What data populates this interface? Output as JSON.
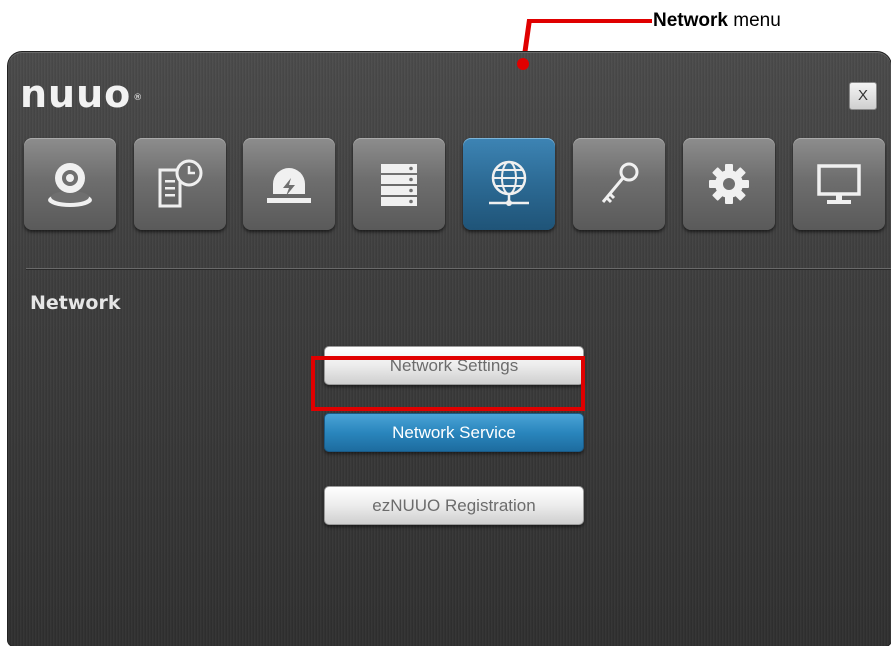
{
  "annotation": {
    "bold": "Network",
    "rest": " menu",
    "color": "#e00000"
  },
  "window": {
    "logo": "nuuo",
    "logo_reg": "®",
    "close_label": "X"
  },
  "toolbar": {
    "items": [
      {
        "name": "camera",
        "icon": "camera-icon",
        "active": false
      },
      {
        "name": "schedule",
        "icon": "schedule-document-icon",
        "active": false
      },
      {
        "name": "event",
        "icon": "alarm-light-icon",
        "active": false
      },
      {
        "name": "storage",
        "icon": "storage-server-icon",
        "active": false
      },
      {
        "name": "network",
        "icon": "globe-network-icon",
        "active": true
      },
      {
        "name": "user",
        "icon": "key-icon",
        "active": false
      },
      {
        "name": "system",
        "icon": "gear-icon",
        "active": false
      },
      {
        "name": "display",
        "icon": "monitor-icon",
        "active": false
      }
    ],
    "active_color": "#2c6a94"
  },
  "section": {
    "title": "Network"
  },
  "menu": {
    "items": [
      {
        "label": "Network Settings",
        "selected": false
      },
      {
        "label": "Network Service",
        "selected": true
      },
      {
        "label": "ezNUUO Registration",
        "selected": false
      }
    ],
    "selected_color": "#2a86bd"
  }
}
